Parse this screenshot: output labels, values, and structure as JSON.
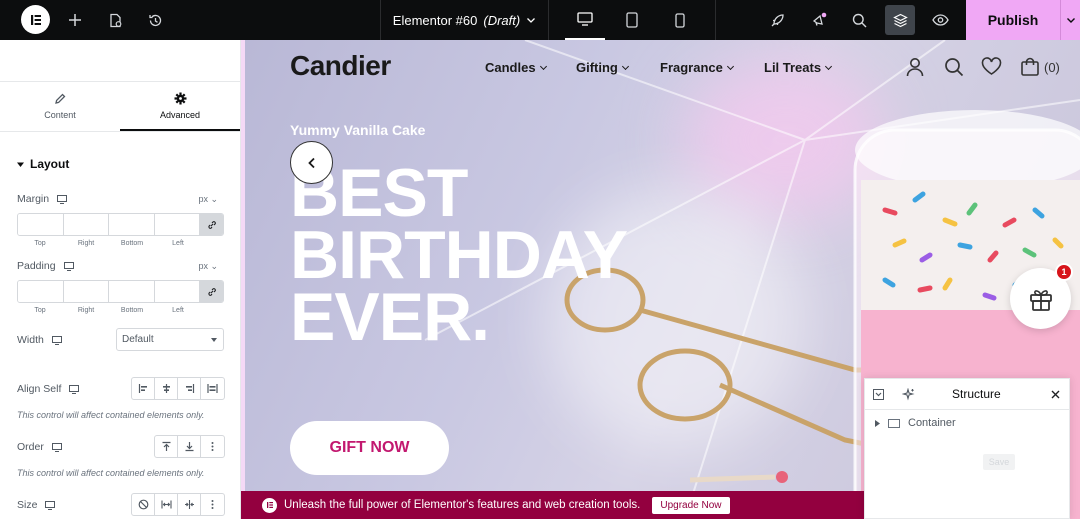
{
  "topbar": {
    "document_title": "Elementor #60",
    "document_status": "(Draft)",
    "publish_label": "Publish",
    "colors": {
      "bar": "#0c0d0e",
      "publish": "#f0a8f5"
    }
  },
  "panel": {
    "tabs": [
      {
        "label": "Content",
        "icon": "pencil-icon"
      },
      {
        "label": "Advanced",
        "icon": "gear-icon",
        "active": true
      }
    ],
    "section_title": "Layout",
    "margin": {
      "label": "Margin",
      "unit": "px"
    },
    "padding": {
      "label": "Padding",
      "unit": "px"
    },
    "dimension_labels": [
      "Top",
      "Right",
      "Bottom",
      "Left"
    ],
    "width": {
      "label": "Width",
      "value": "Default"
    },
    "align_self": {
      "label": "Align Self",
      "note": "This control will affect contained elements only."
    },
    "order": {
      "label": "Order",
      "note": "This control will affect contained elements only."
    },
    "size": {
      "label": "Size"
    }
  },
  "site": {
    "logo": "Candier",
    "nav": [
      "Candles",
      "Gifting",
      "Fragrance",
      "Lil Treats"
    ],
    "cart_count": "(0)",
    "eyebrow": "Yummy Vanilla Cake",
    "hero_lines": [
      "BEST",
      "BIRTHDAY",
      "EVER."
    ],
    "cta": "GIFT NOW",
    "badge_count": "1",
    "accent": "#c2186f"
  },
  "promo": {
    "text": "Unleash the full power of Elementor's features and web creation tools.",
    "button": "Upgrade Now",
    "color": "#93003f"
  },
  "structure": {
    "title": "Structure",
    "item": "Container",
    "ghost_label": "Save"
  }
}
